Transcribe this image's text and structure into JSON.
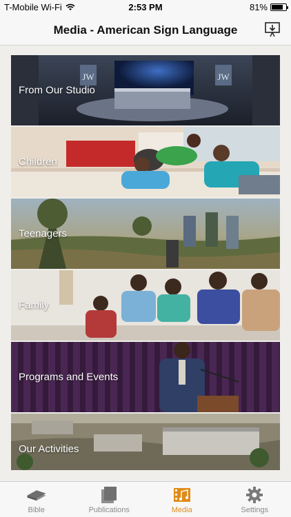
{
  "status_bar": {
    "carrier": "T-Mobile Wi-Fi",
    "time": "2:53 PM",
    "battery": "81%",
    "battery_level": 0.81
  },
  "nav": {
    "title": "Media - American Sign Language",
    "action_icon": "download-icon"
  },
  "tiles": [
    {
      "label": "From Our Studio"
    },
    {
      "label": "Children"
    },
    {
      "label": "Teenagers"
    },
    {
      "label": "Family"
    },
    {
      "label": "Programs and Events"
    },
    {
      "label": "Our Activities"
    }
  ],
  "studio_signs": {
    "left": "JW",
    "right": "JW"
  },
  "tabs": [
    {
      "label": "Bible",
      "icon": "book-icon"
    },
    {
      "label": "Publications",
      "icon": "publications-icon"
    },
    {
      "label": "Media",
      "icon": "media-icon",
      "active": true
    },
    {
      "label": "Settings",
      "icon": "gear-icon"
    }
  ],
  "colors": {
    "accent": "#e08b16",
    "inactive": "#8a8a8a"
  }
}
